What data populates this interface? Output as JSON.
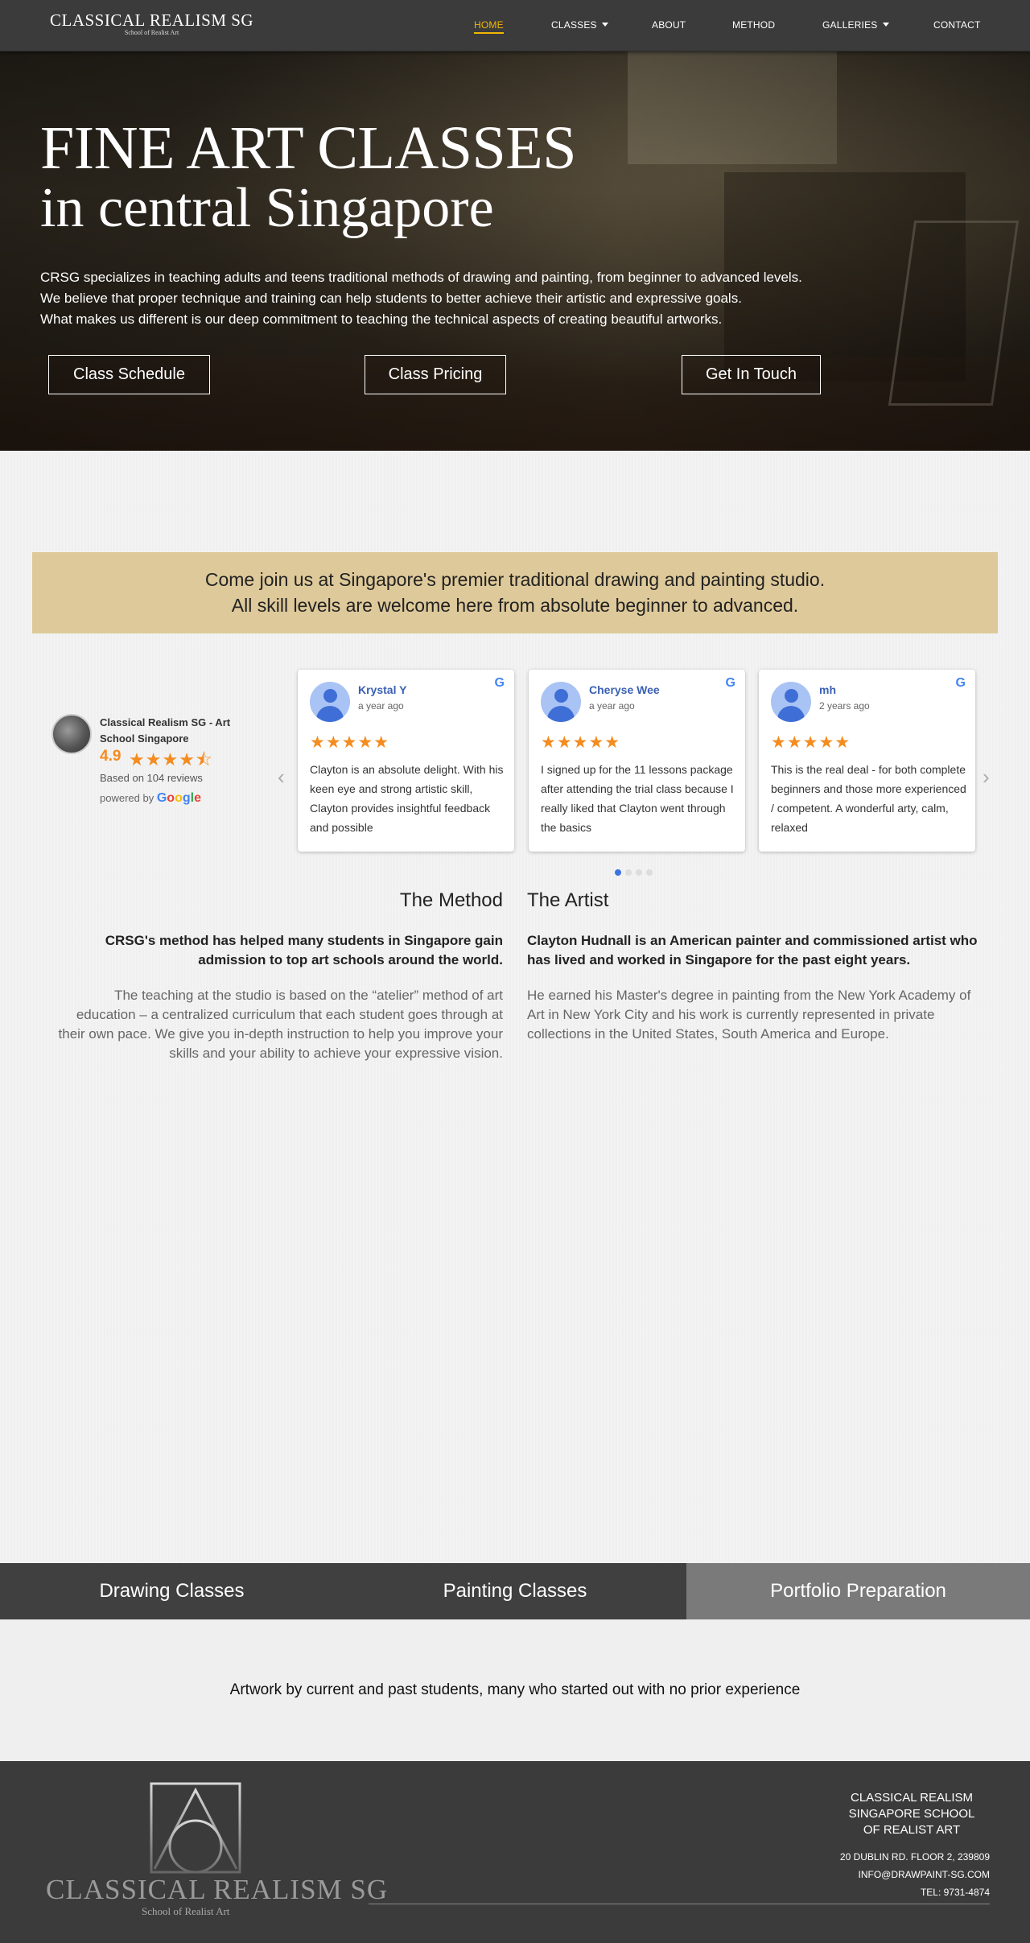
{
  "nav": {
    "logo_main": "CLASSICAL REALISM SG",
    "logo_sub": "School of Realist Art",
    "items": [
      {
        "label": "HOME"
      },
      {
        "label": "CLASSES"
      },
      {
        "label": "ABOUT"
      },
      {
        "label": "METHOD"
      },
      {
        "label": "GALLERIES"
      },
      {
        "label": "CONTACT"
      }
    ],
    "active_color": "#f2b705"
  },
  "hero": {
    "title_line1": "FINE ART CLASSES",
    "title_line2": "in central Singapore",
    "text_line1": "CRSG specializes in teaching adults and teens traditional methods of drawing and painting, from beginner to advanced levels.",
    "text_line2": "We believe that proper technique and training can help students to better achieve their artistic and expressive goals.",
    "text_line3": "What makes us different is our deep commitment to teaching the technical aspects of creating beautiful artworks.",
    "buttons": [
      {
        "label": "Class Schedule"
      },
      {
        "label": "Class Pricing"
      },
      {
        "label": "Get In Touch"
      }
    ]
  },
  "banner": {
    "line1": "Come join us at Singapore's premier traditional drawing and painting studio.",
    "line2": "All skill levels are welcome here from absolute beginner to advanced.",
    "color": "#dec99a"
  },
  "reviews_widget": {
    "business_name": "Classical Realism SG - Art School Singapore",
    "rating": "4.9",
    "stars": "★★★★⯪",
    "based_on": "Based on 104 reviews",
    "powered_by": "powered by",
    "google_letters": [
      "G",
      "o",
      "o",
      "g",
      "l",
      "e"
    ],
    "prev_arrow": "‹",
    "next_arrow": "›",
    "star_color": "#f58c1f",
    "reviews": [
      {
        "name": "Krystal Y",
        "date": "a year ago",
        "stars": "★★★★★",
        "text": "Clayton is an absolute delight. With his keen eye and strong artistic skill, Clayton provides insightful feedback and possible"
      },
      {
        "name": "Cheryse Wee",
        "date": "a year ago",
        "stars": "★★★★★",
        "text": "I signed up for the 11 lessons package after attending the trial class because I really liked that Clayton went through the basics"
      },
      {
        "name": "mh",
        "date": "2 years ago",
        "stars": "★★★★★",
        "text": "This is the real deal - for both complete beginners and those more experienced / competent.  A wonderful arty, calm, relaxed"
      }
    ],
    "google_icon": "G",
    "active_dot": 1,
    "dot_count": 4
  },
  "method": {
    "title": "The Method",
    "lead": "CRSG's method has helped many students in Singapore gain admission to top art schools around the world.",
    "body": "The teaching at the studio is based on the “atelier” method of art education – a centralized curriculum that each student goes through at their own pace. We give you in-depth instruction to help you improve your skills and your ability to achieve your expressive vision."
  },
  "artist": {
    "title": "The Artist",
    "lead": "Clayton Hudnall is an American painter and commissioned artist who has lived and worked in Singapore for the past eight years.",
    "body": "He earned his Master's degree in painting from the New York Academy of Art in New York City and his work is currently represented in private collections in the United States, South America and Europe."
  },
  "tabs": [
    {
      "label": "Drawing Classes"
    },
    {
      "label": "Painting Classes"
    },
    {
      "label": "Portfolio Preparation"
    }
  ],
  "gallery": {
    "caption": "Artwork by current and past students, many who started out with no prior experience"
  },
  "footer": {
    "logo_main": "CLASSICAL REALISM SG",
    "logo_sub": "School of Realist Art",
    "name_line1": "Classical Realism",
    "name_line2": "Singapore School",
    "name_line3": "of Realist Art",
    "address": "20 Dublin Rd. Floor 2, 239809",
    "email": "info@drawpaint-sg.com",
    "phone": "Tel: 9731-4874"
  }
}
